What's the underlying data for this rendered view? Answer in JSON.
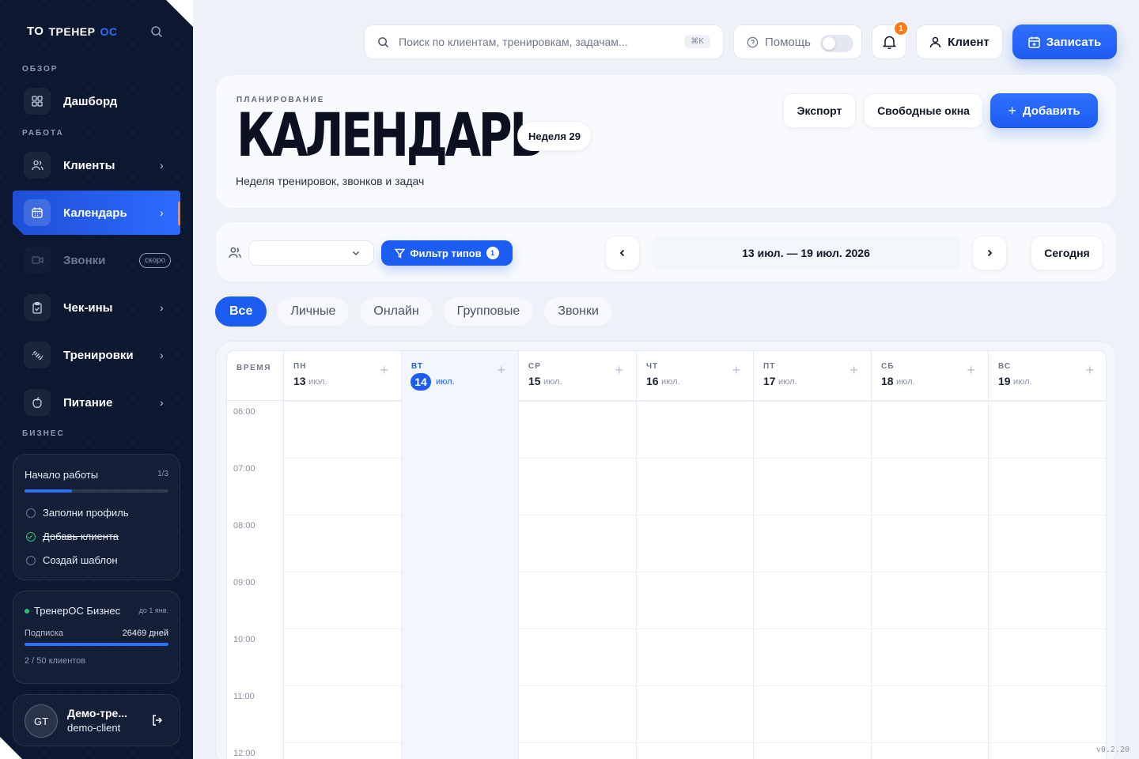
{
  "sidebar": {
    "logo_mark": "ТО",
    "logo_text_a": "ТРЕНЕР",
    "logo_text_b": "ОС",
    "section_overview": "ОБЗОР",
    "section_work": "РАБОТА",
    "section_business": "БИЗНЕС",
    "items": [
      {
        "label": "Дашборд"
      },
      {
        "label": "Клиенты"
      },
      {
        "label": "Календарь"
      },
      {
        "label": "Звонки",
        "badge": "скоро"
      },
      {
        "label": "Чек-ины"
      },
      {
        "label": "Тренировки"
      },
      {
        "label": "Питание"
      }
    ],
    "onboarding": {
      "title": "Начало работы",
      "count": "1/3",
      "progress": 0.33,
      "tasks": [
        {
          "label": "Заполни профиль",
          "done": false
        },
        {
          "label": "Добавь клиента",
          "done": true
        },
        {
          "label": "Создай шаблон",
          "done": false
        }
      ]
    },
    "business": {
      "title": "ТренерОС Бизнес",
      "until": "до 1 янв.",
      "subscription_label": "Подписка",
      "days": "26469 дней",
      "clients": "2 / 50 клиентов"
    },
    "user": {
      "initials": "GT",
      "name": "Демо-тре...",
      "login": "demo-client"
    }
  },
  "topbar": {
    "search_placeholder": "Поиск по клиентам, тренировкам, задачам...",
    "shortcut": "⌘K",
    "help_label": "Помощь",
    "notifications_count": "1",
    "client_label": "Клиент",
    "record_label": "Записать"
  },
  "header": {
    "eyebrow": "ПЛАНИРОВАНИЕ",
    "title": "КАЛЕНДАРЬ",
    "week_chip": "Неделя 29",
    "subtitle": "Неделя тренировок, звонков и задач",
    "export_label": "Экспорт",
    "free_slots_label": "Свободные окна",
    "add_label": "Добавить"
  },
  "toolbar": {
    "client_select_value": "",
    "filter_label": "Фильтр типов",
    "filter_count": "1",
    "range": "13 июл. — 19 июл. 2026",
    "today_label": "Сегодня"
  },
  "tabs": [
    "Все",
    "Личные",
    "Онлайн",
    "Групповые",
    "Звонки"
  ],
  "calendar": {
    "time_header": "ВРЕМЯ",
    "days": [
      {
        "dow": "ПН",
        "num": "13",
        "month": "июл."
      },
      {
        "dow": "ВТ",
        "num": "14",
        "month": "июл.",
        "today": true
      },
      {
        "dow": "СР",
        "num": "15",
        "month": "июл."
      },
      {
        "dow": "ЧТ",
        "num": "16",
        "month": "июл."
      },
      {
        "dow": "ПТ",
        "num": "17",
        "month": "июл."
      },
      {
        "dow": "СБ",
        "num": "18",
        "month": "июл."
      },
      {
        "dow": "ВС",
        "num": "19",
        "month": "июл."
      }
    ],
    "times": [
      "06:00",
      "07:00",
      "08:00",
      "09:00",
      "10:00",
      "11:00",
      "12:00"
    ]
  },
  "version": "v0.2.20",
  "colors": {
    "accent": "#1d5cf0",
    "sidebar_bg": "#0c1830",
    "warning": "#ff7a1a",
    "success": "#2bc276"
  }
}
